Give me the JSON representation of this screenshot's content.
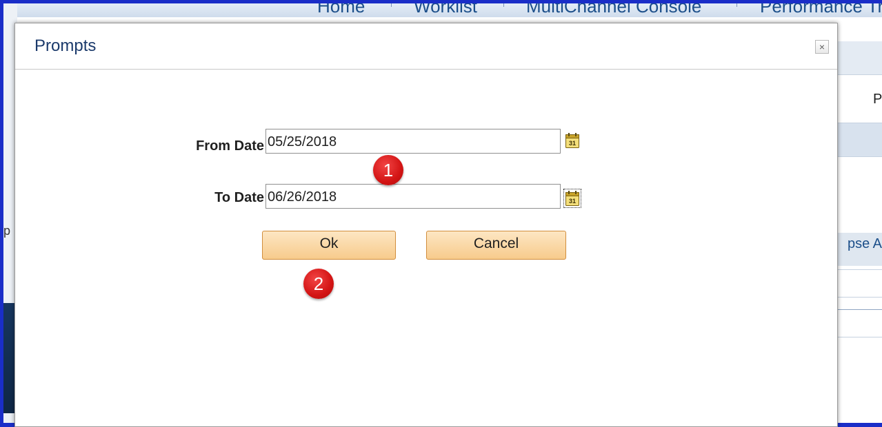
{
  "background": {
    "nav_items": [
      "Home",
      "Worklist",
      "MultiChannel Console",
      "Performance Tr"
    ],
    "right_letter": "P",
    "collapse_text": "pse A",
    "left_glyph": "p"
  },
  "dialog": {
    "title": "Prompts",
    "close_glyph": "×",
    "from_date": {
      "label": "From Date",
      "value": "05/25/2018"
    },
    "to_date": {
      "label": "To Date",
      "value": "06/26/2018"
    },
    "calendar_icon_text": "31",
    "ok_label": "Ok",
    "cancel_label": "Cancel"
  },
  "annotations": {
    "step1": "1",
    "step2": "2"
  },
  "colors": {
    "outer_border": "#1a2ec8",
    "title": "#1b3a6b",
    "button_border": "#d18d3c",
    "button_fill": "#f7cb8c",
    "badge": "#d31414"
  }
}
